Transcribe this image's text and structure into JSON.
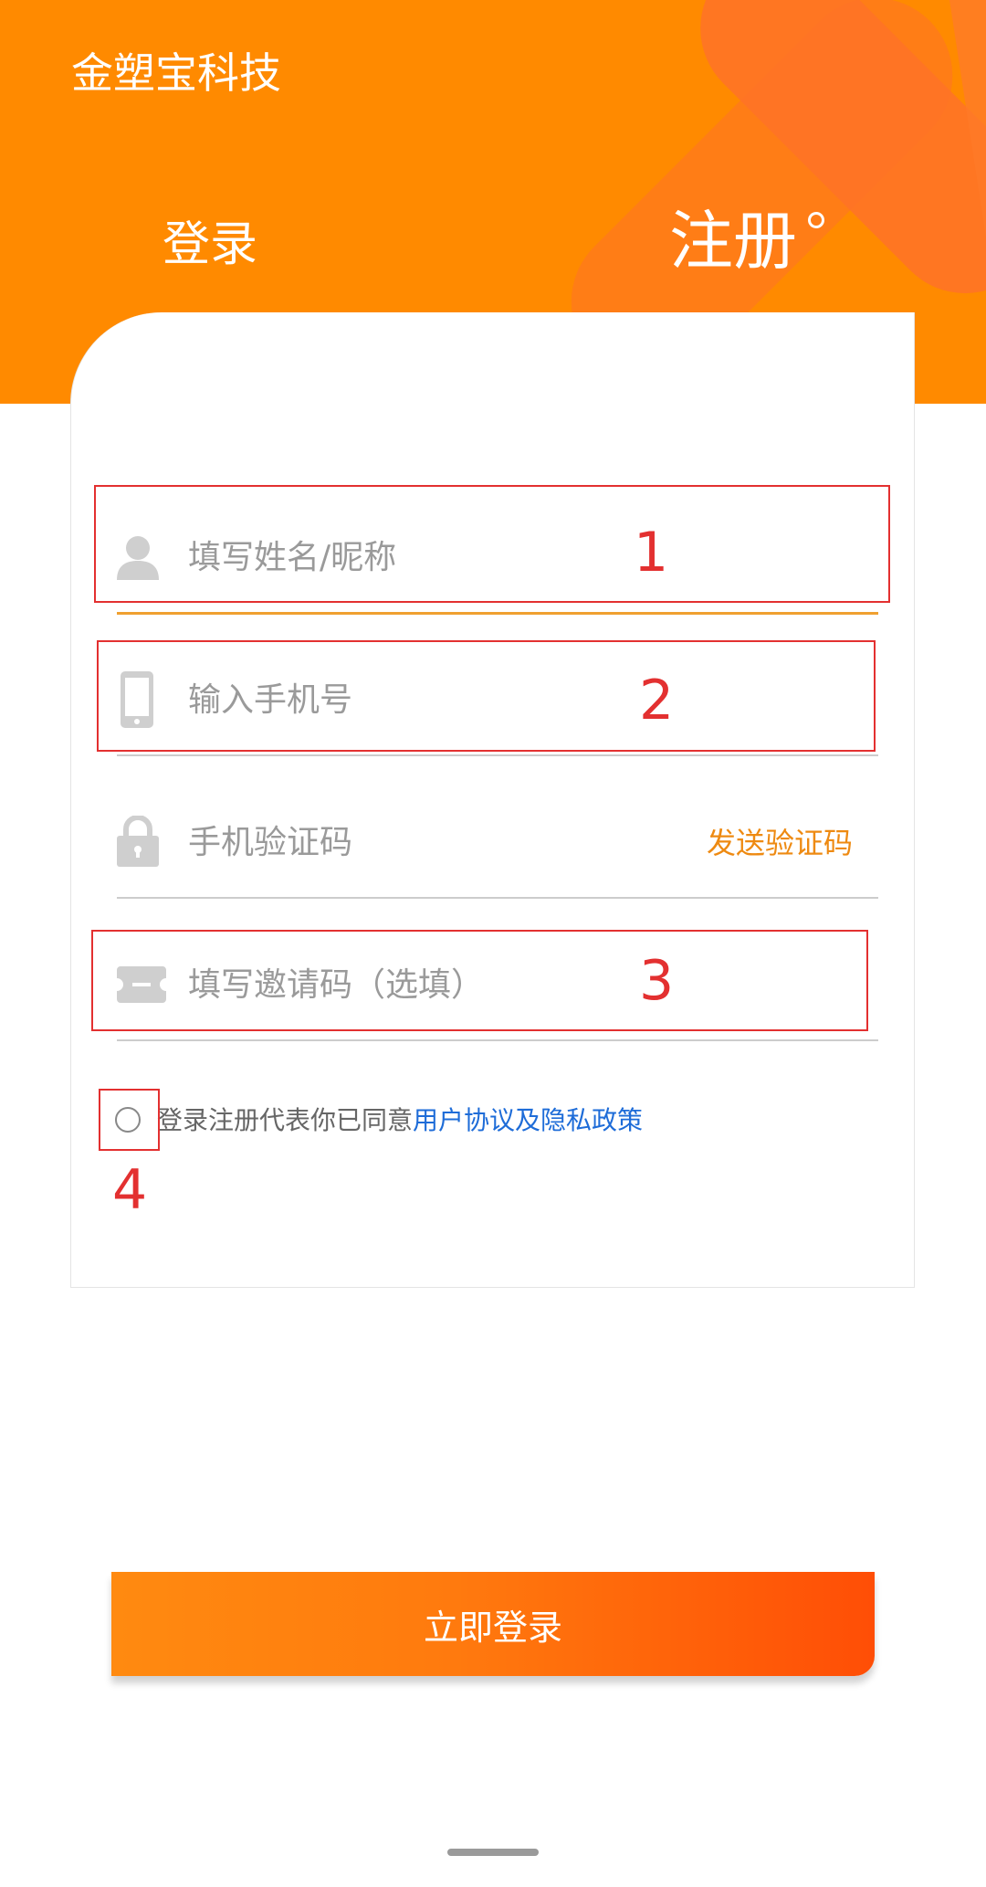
{
  "header": {
    "app_title": "金塑宝科技",
    "tabs": {
      "login": "登录",
      "register": "注册"
    }
  },
  "form": {
    "name_placeholder": "填写姓名/昵称",
    "phone_placeholder": "输入手机号",
    "code_placeholder": "手机验证码",
    "send_code_label": "发送验证码",
    "invite_placeholder": "填写邀请码（选填）",
    "agreement_text": "登录注册代表你已同意",
    "agreement_link": "用户协议及隐私政策",
    "submit_label": "立即登录"
  },
  "annotations": [
    "1",
    "2",
    "3",
    "4"
  ],
  "colors": {
    "brand_orange": "#FF8A00",
    "link_blue": "#1E6CD8",
    "annotation_red": "#E33030"
  }
}
